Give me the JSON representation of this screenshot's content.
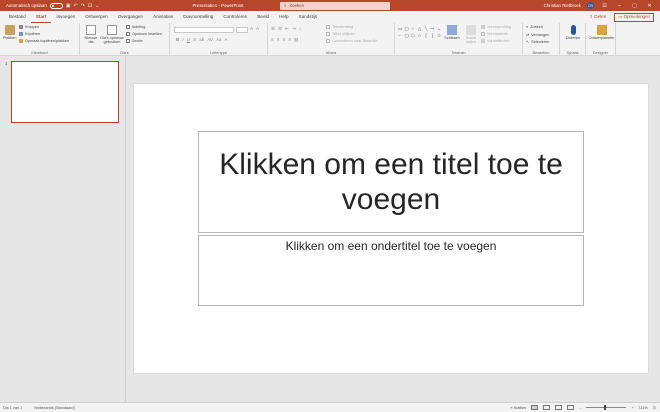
{
  "titlebar": {
    "autosave_label": "Automatisch opslaan",
    "doc_title": "Presentatie1 - PowerPoint",
    "search_placeholder": "Zoeken",
    "user_name": "Christian Rietbroek",
    "user_initials": "CR"
  },
  "tabs": [
    "Bestand",
    "Start",
    "Invoegen",
    "Ontwerpen",
    "Overgangen",
    "Animaties",
    "Diavoorstelling",
    "Controleren",
    "Beeld",
    "Help",
    "Sandstijs"
  ],
  "share": {
    "share_label": "Delen",
    "comments_label": "Opmerkingen"
  },
  "ribbon": {
    "clipboard": {
      "label": "Klembord",
      "paste": "Plakken",
      "cut": "Knippen",
      "copy": "Kopiëren",
      "format_painter": "Opmaak kopiëren/plakken"
    },
    "slides": {
      "label": "Dia's",
      "new_slide": "Nieuwe dia",
      "reuse": "Dia's opnieuw gebruiken",
      "layout": "Indeling",
      "reset": "Opnieuw instellen",
      "section": "Sectie"
    },
    "font": {
      "label": "Lettertype"
    },
    "paragraph": {
      "label": "Alinea",
      "text_direction": "Tekstrichting",
      "align_text": "Tekst uitlijnen",
      "smartart": "Converteren naar SmartArt"
    },
    "drawing": {
      "label": "Tekenen",
      "arrange": "Schikken",
      "quick_styles": "Snelle stijlen",
      "fill": "Vormopvulling",
      "outline": "Vormomtrek",
      "effects": "Vormeffecten"
    },
    "editing": {
      "label": "Bewerken",
      "find": "Zoeken",
      "replace": "Vervangen",
      "select": "Selecteren"
    },
    "voice": {
      "label": "Spraak",
      "dictate": "Dicteren"
    },
    "designer": {
      "label": "Designer",
      "ideas": "Ontwerpideeën"
    }
  },
  "thumbnail": {
    "number": "1"
  },
  "slide": {
    "title_placeholder": "Klikken om een titel toe te voegen",
    "subtitle_placeholder": "Klikken om een ondertitel toe te voegen"
  },
  "statusbar": {
    "slide_info": "Dia 1 van 1",
    "language": "Nederlands (Standaard)",
    "notes": "Notities",
    "zoom": "111%"
  },
  "colors": {
    "accent": "#b7472a",
    "thumb_border": "#c43e1c"
  }
}
